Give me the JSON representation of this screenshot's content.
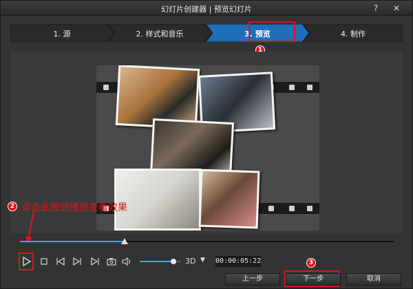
{
  "window": {
    "title": "幻灯片创建器 | 预览幻灯片",
    "help_glyph": "?",
    "close_glyph": "✕"
  },
  "steps": [
    {
      "label": "1. 源",
      "active": false
    },
    {
      "label": "2. 样式和音乐",
      "active": false
    },
    {
      "label": "3. 预览",
      "active": true
    },
    {
      "label": "4. 制作",
      "active": false
    }
  ],
  "annotations": {
    "badge_1": "1",
    "badge_2": "2",
    "badge_3": "3",
    "hint_text": "点击此按钮播放查看效果"
  },
  "player": {
    "progress": 0.28,
    "volume": 0.82,
    "mode_label": "3D",
    "mode_caret": "▼",
    "timecode": "00:00:05:22"
  },
  "buttons": {
    "back": "上一步",
    "next": "下一步",
    "cancel": "取消"
  },
  "icons": {
    "play": "play-icon",
    "stop": "stop-icon",
    "prev": "previous-frame-icon",
    "next": "next-frame-icon",
    "snapshot": "camera-icon",
    "volume": "speaker-icon"
  },
  "colors": {
    "accent": "#39a9e8",
    "annotation": "#e0131a",
    "active_step": "#1d6fb8"
  }
}
